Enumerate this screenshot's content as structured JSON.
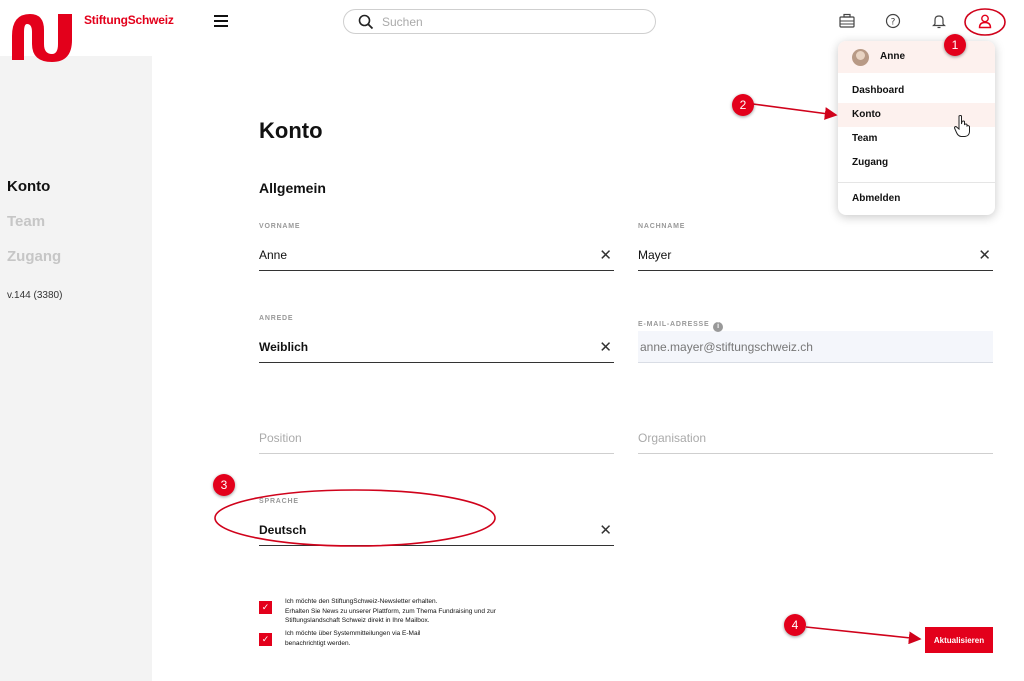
{
  "brand": {
    "name": "StiftungSchweiz",
    "color": "#e3001b"
  },
  "sidebar": {
    "items": [
      {
        "label": "Konto",
        "active": true
      },
      {
        "label": "Team",
        "active": false
      },
      {
        "label": "Zugang",
        "active": false
      }
    ],
    "version": "v.144 (3380)"
  },
  "header": {
    "search_placeholder": "Suchen",
    "icons": [
      "briefcase-icon",
      "help-icon",
      "bell-icon",
      "user-icon"
    ]
  },
  "page": {
    "title": "Konto",
    "section": "Allgemein"
  },
  "form": {
    "vorname": {
      "label": "VORNAME",
      "value": "Anne"
    },
    "nachname": {
      "label": "NACHNAME",
      "value": "Mayer"
    },
    "anrede": {
      "label": "ANREDE",
      "value": "Weiblich"
    },
    "email": {
      "label": "E-MAIL-ADRESSE",
      "value": "anne.mayer@stiftungschweiz.ch"
    },
    "position": {
      "placeholder": "Position"
    },
    "organisation": {
      "placeholder": "Organisation"
    },
    "sprache": {
      "label": "SPRACHE",
      "value": "Deutsch"
    }
  },
  "checkboxes": [
    {
      "checked": true,
      "lines": [
        "Ich möchte den StiftungSchweiz-Newsletter erhalten.",
        "Erhalten Sie News zu unserer Plattform, zum Thema Fundraising und zur",
        "Stiftungslandschaft Schweiz direkt in Ihre Mailbox."
      ]
    },
    {
      "checked": true,
      "lines": [
        "Ich möchte über Systemmitteilungen via E-Mail",
        "benachrichtigt werden."
      ]
    }
  ],
  "update_button": "Aktualisieren",
  "dropdown": {
    "user_name": "Anne",
    "items": [
      "Dashboard",
      "Konto",
      "Team",
      "Zugang",
      "Abmelden"
    ]
  },
  "annotations": [
    "1",
    "2",
    "3",
    "4"
  ]
}
